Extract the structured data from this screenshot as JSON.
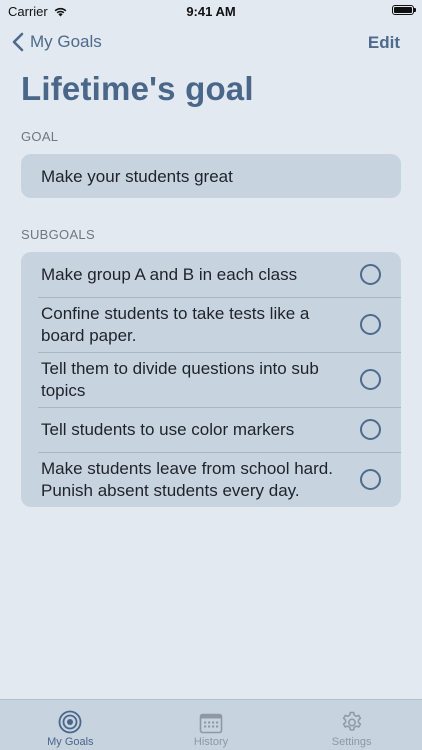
{
  "status_bar": {
    "carrier": "Carrier",
    "time": "9:41 AM"
  },
  "nav": {
    "back_label": "My Goals",
    "edit_label": "Edit"
  },
  "page_title": "Lifetime's goal",
  "goal_section": {
    "header": "GOAL",
    "text": "Make your students great"
  },
  "subgoals_section": {
    "header": "SUBGOALS",
    "items": [
      {
        "label": "Make group A and B in each class",
        "completed": false
      },
      {
        "label": "Confine students to take tests like a board paper.",
        "completed": false
      },
      {
        "label": "Tell them to divide questions into sub topics",
        "completed": false
      },
      {
        "label": "Tell students to use color markers",
        "completed": false
      },
      {
        "label": "Make students leave from school hard. Punish absent students every day.",
        "completed": false
      }
    ]
  },
  "tab_bar": {
    "tabs": [
      {
        "label": "My Goals",
        "icon": "target-icon",
        "active": true
      },
      {
        "label": "History",
        "icon": "calendar-icon",
        "active": false
      },
      {
        "label": "Settings",
        "icon": "gear-icon",
        "active": false
      }
    ]
  },
  "colors": {
    "background": "#e2e9f1",
    "card": "#c7d3df",
    "accent": "#4a6689",
    "inactive": "#8f98a3"
  }
}
